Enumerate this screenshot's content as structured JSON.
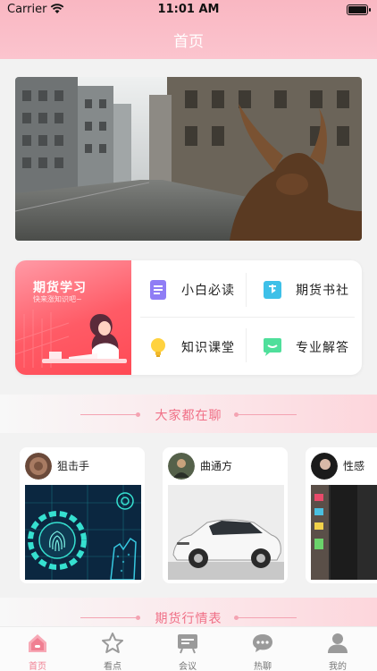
{
  "status_bar": {
    "carrier": "Carrier",
    "time": "11:01 AM"
  },
  "nav": {
    "title": "首页"
  },
  "banner": {
    "image": "wall-street-bull-photo"
  },
  "learn": {
    "title": "期货学习",
    "subtitle": "快来涨知识吧~",
    "items": [
      {
        "label": "小白必读",
        "icon": "document-icon",
        "color": "#8f7df5"
      },
      {
        "label": "期货书社",
        "icon": "book-icon",
        "color": "#3ec0e8"
      },
      {
        "label": "知识课堂",
        "icon": "lightbulb-icon",
        "color": "#ffd23f"
      },
      {
        "label": "专业解答",
        "icon": "chat-bubble-icon",
        "color": "#4fdf9b"
      }
    ]
  },
  "section_chat": {
    "title": "大家都在聊"
  },
  "chats": [
    {
      "name": "狙击手",
      "thumb": "fingerprint-tech-image"
    },
    {
      "name": "曲通方",
      "thumb": "white-car-image"
    },
    {
      "name": "性感",
      "thumb": "street-scene-image"
    }
  ],
  "section_market": {
    "title": "期货行情表"
  },
  "tabs": [
    {
      "label": "首页",
      "icon": "home-icon",
      "active": true
    },
    {
      "label": "看点",
      "icon": "star-icon",
      "active": false
    },
    {
      "label": "会议",
      "icon": "meeting-icon",
      "active": false
    },
    {
      "label": "热聊",
      "icon": "chat-icon",
      "active": false
    },
    {
      "label": "我的",
      "icon": "person-icon",
      "active": false
    }
  ],
  "colors": {
    "accent": "#f07f92",
    "nav": "#fbc4ce",
    "learn_red": "#ff5b66"
  }
}
